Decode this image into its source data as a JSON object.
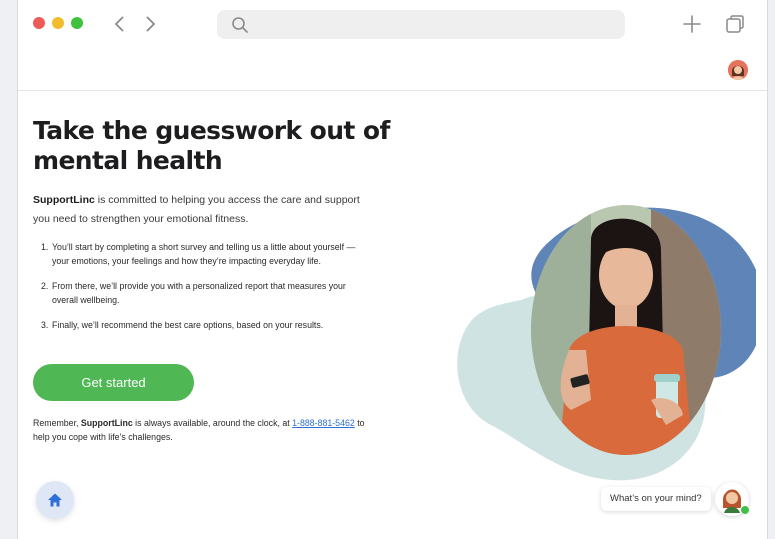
{
  "browser": {
    "icons": {
      "back": "chevron-left-icon",
      "forward": "chevron-right-icon",
      "search": "search-icon",
      "new_tab": "plus-icon",
      "tabs": "tabs-icon"
    },
    "url": ""
  },
  "header": {
    "avatar": "user-avatar"
  },
  "main": {
    "headline": "Take the guesswork out of mental health",
    "intro_brand": "SupportLinc",
    "intro_rest": " is committed to helping you access the care and support you need to strengthen your emotional fitness.",
    "steps": [
      {
        "num": "1.",
        "text": "You’ll start by completing a short survey and telling us a little about yourself — your emotions, your feelings and how they’re impacting everyday life."
      },
      {
        "num": "2.",
        "text": "From there, we’ll provide you with a personalized report that measures your overall wellbeing."
      },
      {
        "num": "3.",
        "text": "Finally, we’ll recommend the best care options, based on your results."
      }
    ],
    "cta_label": "Get started",
    "reminder_pre": "Remember, ",
    "reminder_brand": "SupportLinc",
    "reminder_mid": " is always available, around the clock, at ",
    "reminder_phone": "1-888-881-5462",
    "reminder_post": " to help you cope with life’s challenges."
  },
  "chat": {
    "prompt": "What’s on your mind?",
    "status": "online"
  },
  "colors": {
    "cta": "#4fb854",
    "link": "#2f6fd8",
    "blob_blue": "#5e84b8",
    "blob_mint": "#cfe3e3",
    "home_button": "#dfe6f6"
  }
}
